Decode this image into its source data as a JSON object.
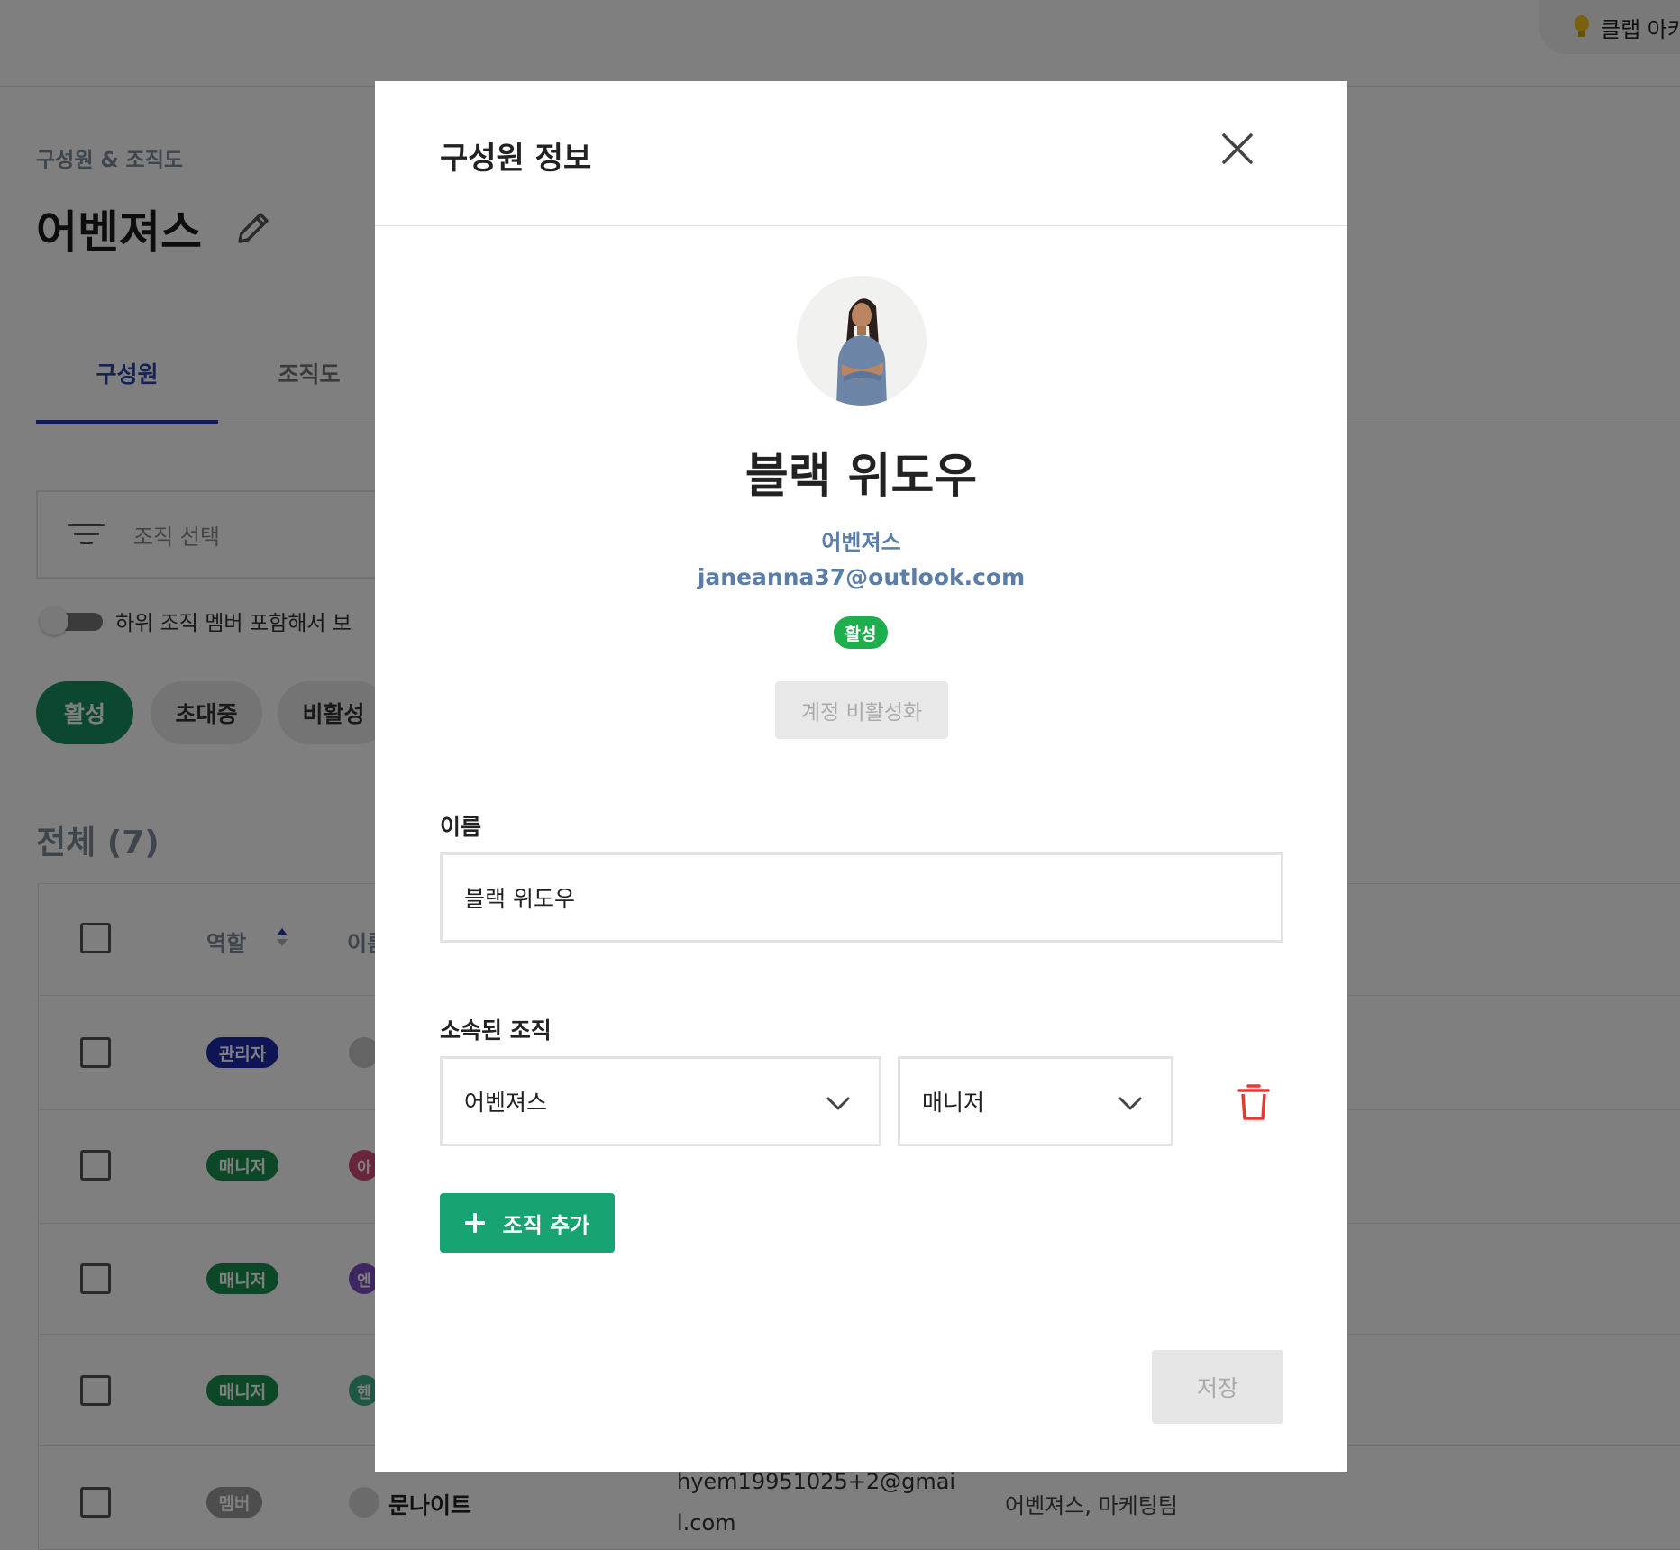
{
  "header": {
    "club_label": "클랩 아카",
    "bulb_icon": "lightbulb-icon"
  },
  "page": {
    "breadcrumb": "구성원 & 조직도",
    "org_title": "어벤져스",
    "edit_icon": "pencil-icon"
  },
  "tabs": [
    {
      "label": "구성원",
      "active": true
    },
    {
      "label": "조직도",
      "active": false
    }
  ],
  "filter": {
    "placeholder": "조직 선택",
    "icon": "filter-icon"
  },
  "toggle": {
    "label": "하위 조직 멤버 포함해서 보",
    "on": false
  },
  "status_chips": [
    {
      "label": "활성",
      "selected": true
    },
    {
      "label": "초대중",
      "selected": false
    },
    {
      "label": "비활성",
      "selected": false
    }
  ],
  "total_label": "전체 (7)",
  "table": {
    "header": {
      "role": "역할",
      "name": "이름"
    },
    "rows": [
      {
        "role": "관리자",
        "name_visible": "",
        "avatar_letter": "",
        "avatar_color": "#c9c9c9"
      },
      {
        "role": "매니저",
        "name_visible": "",
        "avatar_letter": "아",
        "avatar_color": "#d14a78"
      },
      {
        "role": "매니저",
        "name_visible": "",
        "avatar_letter": "엔",
        "avatar_color": "#7d4cc2"
      },
      {
        "role": "매니저",
        "name_visible": "",
        "avatar_letter": "헨",
        "avatar_color": "#3fae8a"
      },
      {
        "role": "멤버",
        "name": "문나이트",
        "email": "hyem19951025+2@gmai l.com",
        "orgs": "어벤져스, 마케팅팀",
        "avatar_letter": "",
        "avatar_color": "#d8d8d8"
      }
    ]
  },
  "modal": {
    "title": "구성원 정보",
    "close_icon": "close-icon",
    "member": {
      "name": "블랙 위도우",
      "org": "어벤져스",
      "email": "janeanna37@outlook.com",
      "status": "활성",
      "status_color": "#1fae4e"
    },
    "deactivate_label": "계정 비활성화",
    "name_field": {
      "label": "이름",
      "value": "블랙 위도우"
    },
    "org_section": {
      "label": "소속된 조직",
      "org_value": "어벤져스",
      "role_value": "매니저",
      "delete_icon": "trash-icon"
    },
    "add_org_label": "조직 추가",
    "save_label": "저장"
  },
  "colors": {
    "primary_green": "#17a472",
    "active_tab": "#2237a8",
    "delete_red": "#e53935",
    "link_blue": "#5b7ea8"
  }
}
